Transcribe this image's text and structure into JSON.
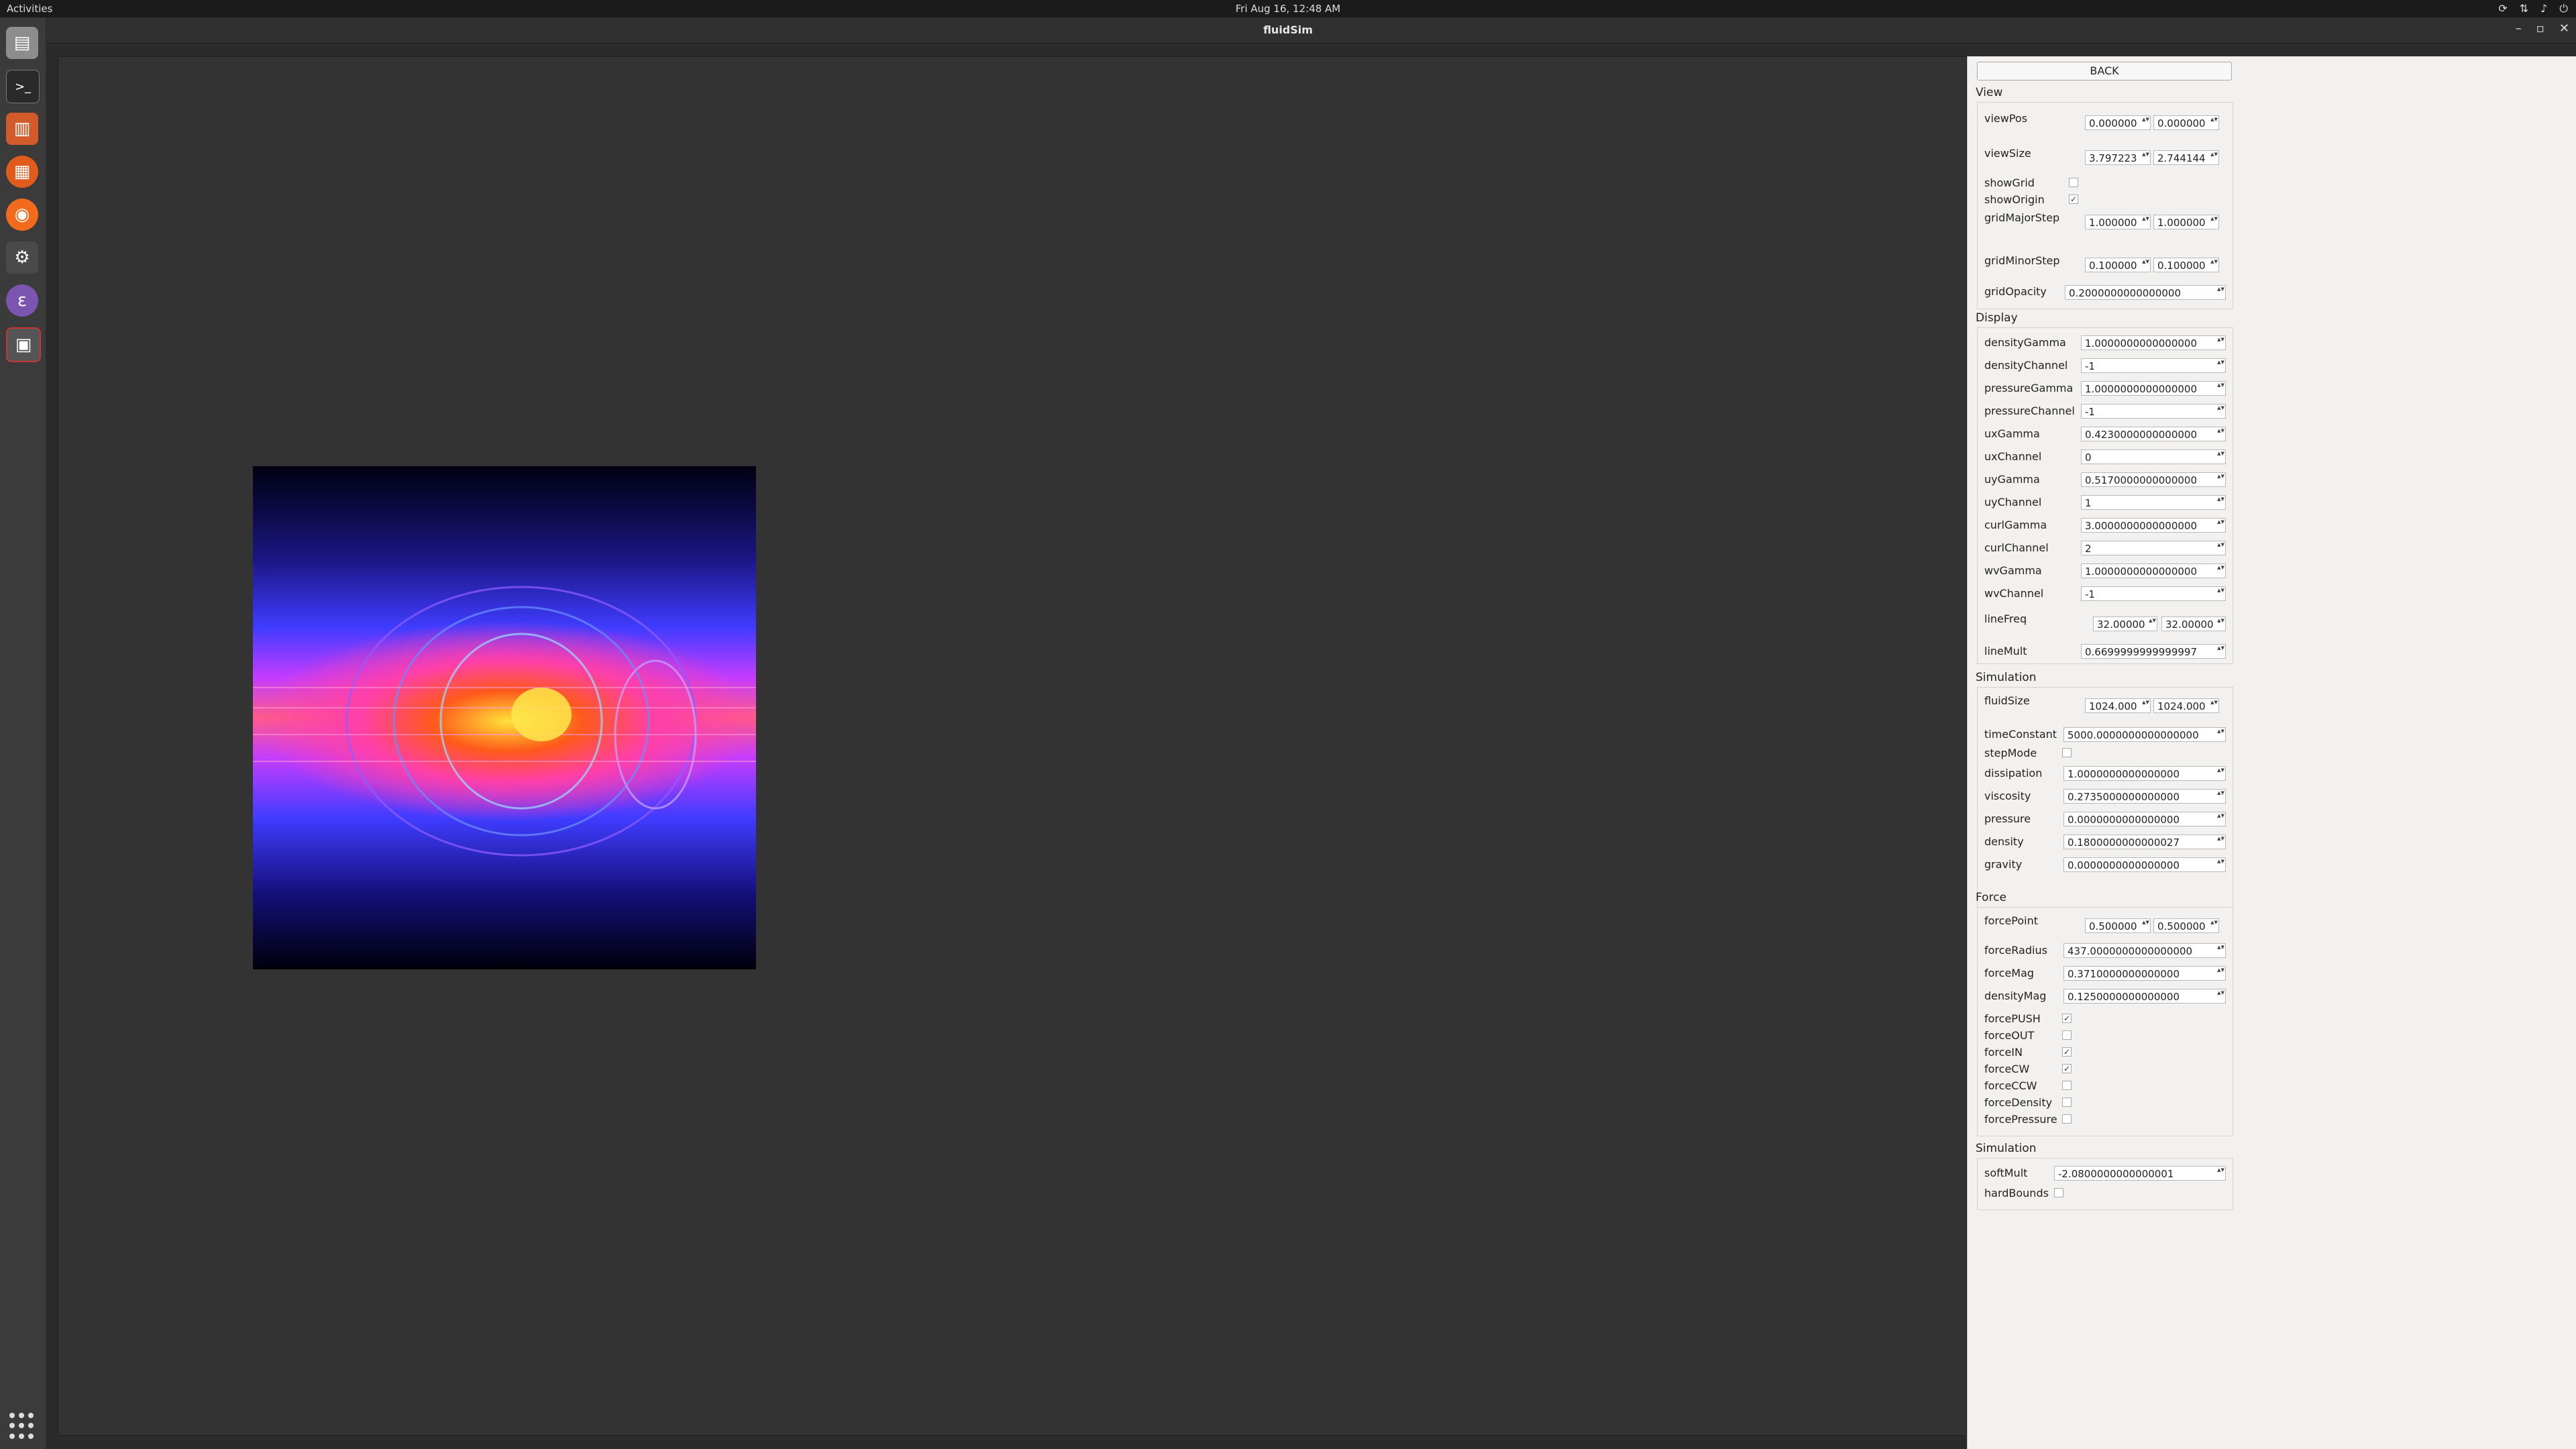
{
  "topbar": {
    "activities": "Activities",
    "clock": "Fri Aug 16, 12:48 AM"
  },
  "window": {
    "title": "fluidSim",
    "minimize": "–",
    "maximize": "▫",
    "close": "✕"
  },
  "dock": [
    "files-icon",
    "terminal-icon",
    "text-editor-icon",
    "software-icon",
    "firefox-icon",
    "settings-app-icon",
    "emacs-icon",
    "fluidsim-app-icon"
  ],
  "panel": {
    "back": "BACK",
    "view": {
      "title": "View",
      "viewPos": {
        "label": "viewPos",
        "a": "0.000000",
        "b": "0.000000"
      },
      "viewSize": {
        "label": "viewSize",
        "a": "3.797223",
        "b": "2.744144"
      },
      "showGrid": {
        "label": "showGrid",
        "checked": false
      },
      "showOrigin": {
        "label": "showOrigin",
        "checked": true
      },
      "gridMajorStep": {
        "label": "gridMajorStep",
        "a": "1.000000",
        "b": "1.000000"
      },
      "gridMinorStep": {
        "label": "gridMinorStep",
        "a": "0.100000",
        "b": "0.100000"
      },
      "gridOpacity": {
        "label": "gridOpacity",
        "value": "0.2000000000000000"
      }
    },
    "display": {
      "title": "Display",
      "rows": [
        {
          "label": "densityGamma",
          "value": "1.0000000000000000"
        },
        {
          "label": "densityChannel",
          "value": "-1"
        },
        {
          "label": "pressureGamma",
          "value": "1.0000000000000000"
        },
        {
          "label": "pressureChannel",
          "value": "-1"
        },
        {
          "label": "uxGamma",
          "value": "0.4230000000000000"
        },
        {
          "label": "uxChannel",
          "value": "0"
        },
        {
          "label": "uyGamma",
          "value": "0.5170000000000000"
        },
        {
          "label": "uyChannel",
          "value": "1"
        },
        {
          "label": "curlGamma",
          "value": "3.0000000000000000"
        },
        {
          "label": "curlChannel",
          "value": "2"
        },
        {
          "label": "wvGamma",
          "value": "1.0000000000000000"
        },
        {
          "label": "wvChannel",
          "value": "-1"
        }
      ],
      "lineFreq": {
        "label": "lineFreq",
        "a": "32.00000",
        "b": "32.00000"
      },
      "lineMult": {
        "label": "lineMult",
        "value": "0.6699999999999997"
      }
    },
    "simulation": {
      "title": "Simulation",
      "fluidSize": {
        "label": "fluidSize",
        "a": "1024.000",
        "b": "1024.000"
      },
      "timeConstant": {
        "label": "timeConstant",
        "value": "5000.0000000000000000"
      },
      "stepMode": {
        "label": "stepMode",
        "checked": false
      },
      "rows": [
        {
          "label": "dissipation",
          "value": "1.0000000000000000"
        },
        {
          "label": "viscosity",
          "value": "0.2735000000000000"
        },
        {
          "label": "pressure",
          "value": "0.0000000000000000"
        },
        {
          "label": "density",
          "value": "0.1800000000000027"
        },
        {
          "label": "gravity",
          "value": "0.0000000000000000"
        }
      ]
    },
    "force": {
      "title": "Force",
      "forcePoint": {
        "label": "forcePoint",
        "a": "0.500000",
        "b": "0.500000"
      },
      "rows": [
        {
          "label": "forceRadius",
          "value": "437.0000000000000000"
        },
        {
          "label": "forceMag",
          "value": "0.3710000000000000"
        },
        {
          "label": "densityMag",
          "value": "0.1250000000000000"
        }
      ],
      "checks": [
        {
          "label": "forcePUSH",
          "checked": true
        },
        {
          "label": "forceOUT",
          "checked": false
        },
        {
          "label": "forceIN",
          "checked": true
        },
        {
          "label": "forceCW",
          "checked": true
        },
        {
          "label": "forceCCW",
          "checked": false
        },
        {
          "label": "forceDensity",
          "checked": false
        },
        {
          "label": "forcePressure",
          "checked": false
        }
      ]
    },
    "simulation2": {
      "title": "Simulation",
      "softMult": {
        "label": "softMult",
        "value": "-2.0800000000000001"
      },
      "hardBounds": {
        "label": "hardBounds",
        "checked": false
      }
    },
    "check_mark": "✓",
    "spin_arrows": "▲▼"
  }
}
